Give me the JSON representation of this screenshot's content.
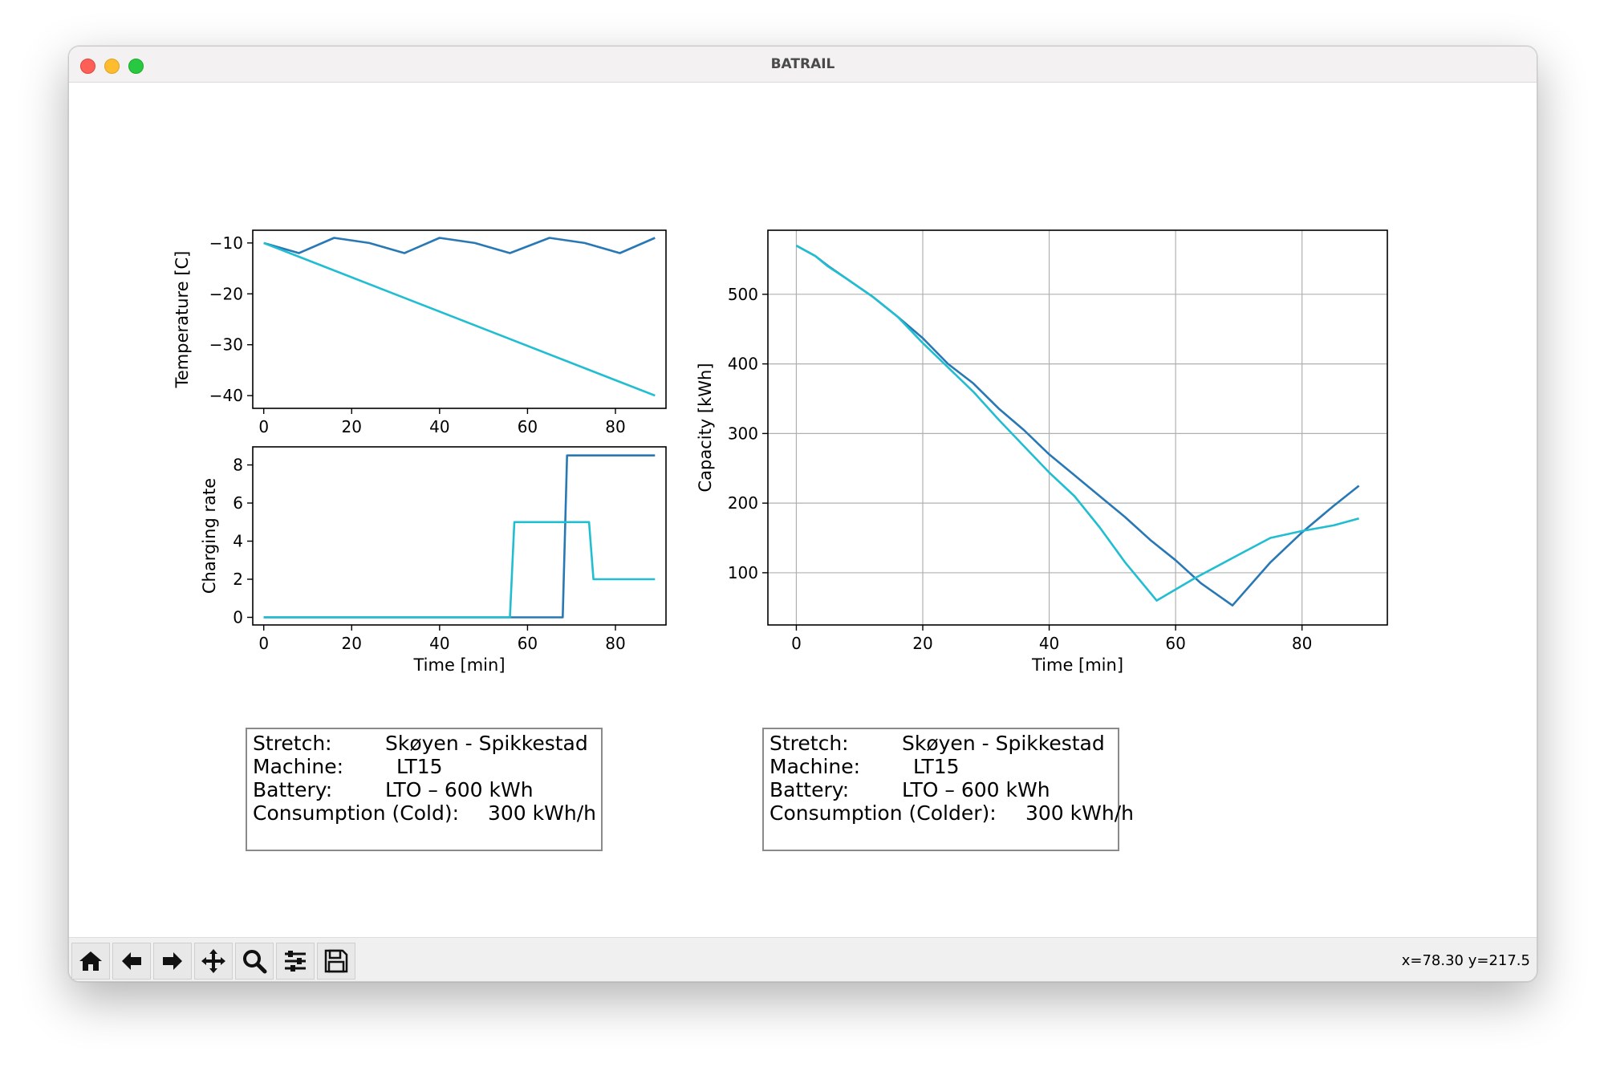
{
  "window": {
    "title": "BATRAIL"
  },
  "status": {
    "coords": "x=78.30 y=217.5"
  },
  "toolbar": {
    "buttons": [
      {
        "name": "home-icon"
      },
      {
        "name": "back-arrow-icon"
      },
      {
        "name": "forward-arrow-icon"
      },
      {
        "name": "pan-icon"
      },
      {
        "name": "zoom-icon"
      },
      {
        "name": "configure-subplots-icon"
      },
      {
        "name": "save-icon"
      }
    ]
  },
  "info_boxes": [
    {
      "stretch_label": "Stretch:",
      "stretch": "Skøyen - Spikkestad",
      "machine_label": "Machine:",
      "machine": "LT15",
      "battery_label": "Battery:",
      "battery": "LTO – 600 kWh",
      "consumption_label": "Consumption (Cold):",
      "consumption": "300 kWh/h"
    },
    {
      "stretch_label": "Stretch:",
      "stretch": "Skøyen - Spikkestad",
      "machine_label": "Machine:",
      "machine": "LT15",
      "battery_label": "Battery:",
      "battery": "LTO – 600 kWh",
      "consumption_label": "Consumption (Colder):",
      "consumption": "300 kWh/h"
    }
  ],
  "colors": {
    "series_a": "#2878b5",
    "series_b": "#21bdd1"
  },
  "chart_data": [
    {
      "id": "temperature",
      "type": "line",
      "ylabel": "Temperature [C]",
      "xlabel": "",
      "xlim": [
        -2.5,
        91.5
      ],
      "ylim": [
        -42.5,
        -7.5
      ],
      "xticks": [
        0,
        20,
        40,
        60,
        80
      ],
      "yticks": [
        -10,
        -20,
        -30,
        -40
      ],
      "ytick_labels": [
        "−10",
        "−20",
        "−30",
        "−40"
      ],
      "grid": false,
      "series": [
        {
          "color": "#2878b5",
          "x": [
            0,
            8,
            16,
            24,
            32,
            40,
            48,
            56,
            65,
            73,
            81,
            89
          ],
          "y": [
            -10,
            -12,
            -9,
            -10,
            -12,
            -9,
            -10,
            -12,
            -9,
            -10,
            -12,
            -9
          ]
        },
        {
          "color": "#21bdd1",
          "x": [
            0,
            89
          ],
          "y": [
            -10,
            -40
          ]
        }
      ]
    },
    {
      "id": "charging",
      "type": "line",
      "ylabel": "Charging rate",
      "xlabel": "Time [min]",
      "xlim": [
        -2.5,
        91.5
      ],
      "ylim": [
        -0.4,
        8.95
      ],
      "xticks": [
        0,
        20,
        40,
        60,
        80
      ],
      "yticks": [
        0,
        2,
        4,
        6,
        8
      ],
      "grid": false,
      "series": [
        {
          "color": "#2878b5",
          "x": [
            0,
            68,
            69,
            89
          ],
          "y": [
            0,
            0,
            8.5,
            8.5
          ]
        },
        {
          "color": "#21bdd1",
          "x": [
            0,
            56,
            57,
            74,
            75,
            89
          ],
          "y": [
            0,
            0,
            5,
            5,
            2,
            2
          ]
        }
      ]
    },
    {
      "id": "capacity",
      "type": "line",
      "ylabel": "Capacity [kWh]",
      "xlabel": "Time [min]",
      "xlim": [
        -4.5,
        93.5
      ],
      "ylim": [
        25,
        592
      ],
      "xticks": [
        0,
        20,
        40,
        60,
        80
      ],
      "yticks": [
        100,
        200,
        300,
        400,
        500
      ],
      "grid": true,
      "series": [
        {
          "color": "#2878b5",
          "x": [
            0,
            3,
            5,
            8,
            12,
            16,
            20,
            24,
            28,
            32,
            36,
            40,
            44,
            48,
            52,
            56,
            60,
            64,
            69,
            75,
            80,
            85,
            89
          ],
          "y": [
            570,
            555,
            541,
            522,
            497,
            468,
            437,
            400,
            372,
            336,
            305,
            270,
            240,
            210,
            180,
            147,
            118,
            85,
            53,
            115,
            158,
            196,
            225
          ]
        },
        {
          "color": "#21bdd1",
          "x": [
            0,
            3,
            5,
            8,
            12,
            16,
            20,
            24,
            28,
            32,
            36,
            40,
            44,
            48,
            52,
            57,
            63,
            70,
            75,
            80,
            85,
            89
          ],
          "y": [
            570,
            555,
            540,
            522,
            497,
            468,
            430,
            395,
            360,
            320,
            282,
            244,
            210,
            165,
            115,
            60,
            92,
            126,
            150,
            160,
            168,
            178
          ]
        }
      ]
    }
  ]
}
